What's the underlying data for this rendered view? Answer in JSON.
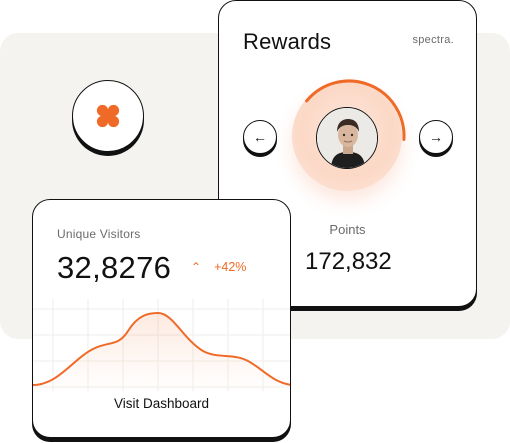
{
  "colors": {
    "accent": "#f06a27",
    "backdrop": "#f4f3ef",
    "ink": "#111111",
    "muted": "#6b6b6b"
  },
  "logo_badge": {
    "icon": "four-petal-flower-icon"
  },
  "rewards": {
    "title": "Rewards",
    "brand": "spectra.",
    "prev_icon": "arrow-left-icon",
    "next_icon": "arrow-right-icon",
    "avatar_icon": "user-avatar-icon",
    "points_label": "Points",
    "points_value": "172,832",
    "progress_fraction": 0.4
  },
  "visitors": {
    "label": "Unique Visitors",
    "value": "32,8276",
    "trend_icon": "chevron-up-icon",
    "change": "+42%",
    "cta": "Visit Dashboard"
  }
}
